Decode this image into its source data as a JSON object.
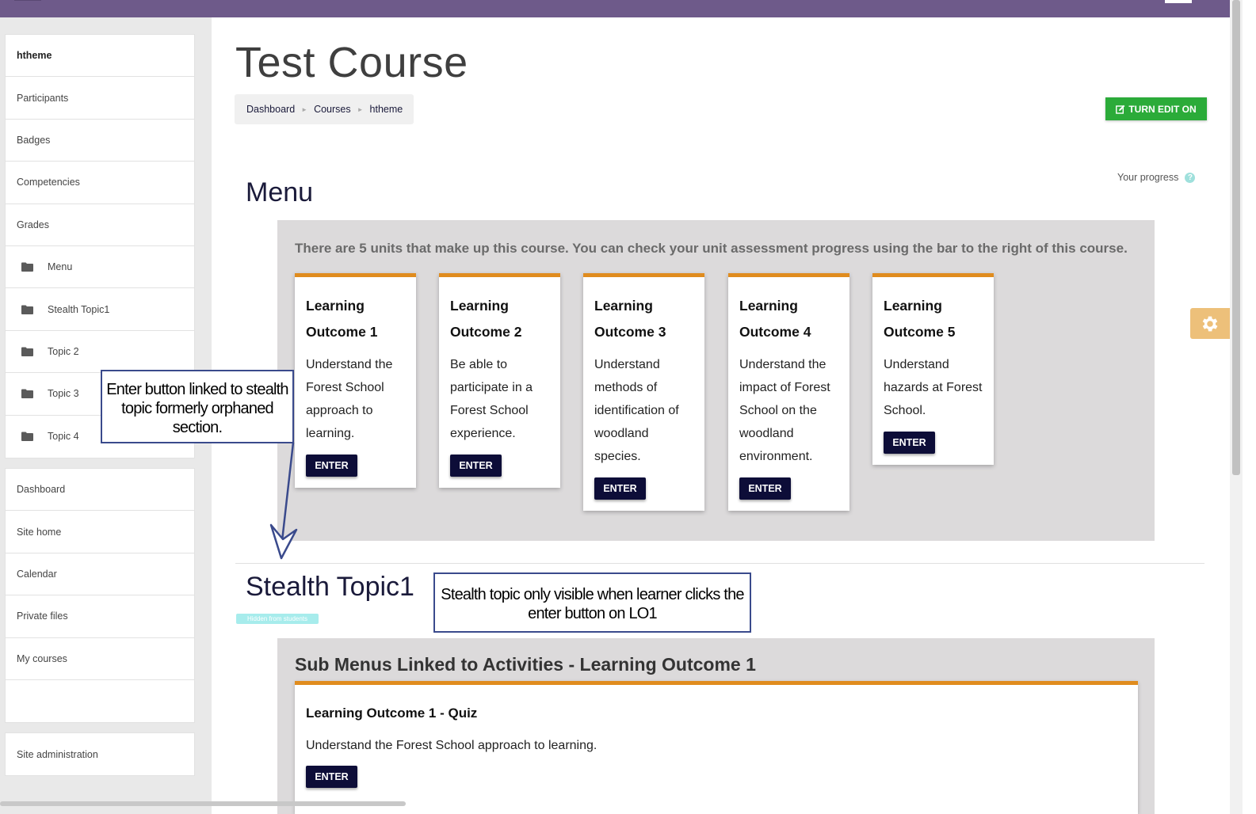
{
  "sidebar": {
    "block1": [
      {
        "label": "htheme",
        "bold": true
      },
      {
        "label": "Participants"
      },
      {
        "label": "Badges"
      },
      {
        "label": "Competencies"
      },
      {
        "label": "Grades"
      },
      {
        "label": "Menu",
        "icon": "folder-icon"
      },
      {
        "label": "Stealth Topic1",
        "icon": "folder-icon"
      },
      {
        "label": "Topic 2",
        "icon": "folder-icon"
      },
      {
        "label": "Topic 3",
        "icon": "folder-icon"
      },
      {
        "label": "Topic 4",
        "icon": "folder-icon"
      }
    ],
    "block2": [
      {
        "label": "Dashboard"
      },
      {
        "label": "Site home"
      },
      {
        "label": "Calendar"
      },
      {
        "label": "Private files"
      },
      {
        "label": "My courses"
      },
      {
        "label": ""
      }
    ],
    "block3": [
      {
        "label": "Site administration"
      }
    ]
  },
  "header": {
    "title": "Test Course",
    "breadcrumb": [
      "Dashboard",
      "Courses",
      "htheme"
    ],
    "edit_button": "TURN EDIT ON",
    "progress_label": "Your progress",
    "help_glyph": "?"
  },
  "menu_section": {
    "title": "Menu",
    "intro": "There are 5 units that make up this course. You can check your unit assessment progress using the bar to the right of this course.",
    "cards": [
      {
        "title": "Learning Outcome 1",
        "desc": "Understand the Forest School approach to learning.",
        "button": "ENTER"
      },
      {
        "title": "Learning Outcome 2",
        "desc": "Be able to participate in a Forest School experience.",
        "button": "ENTER"
      },
      {
        "title": "Learning Outcome 3",
        "desc": "Understand methods of identification of woodland species.",
        "button": "ENTER"
      },
      {
        "title": "Learning Outcome 4",
        "desc": "Understand the impact of Forest School on the woodland environment.",
        "button": "ENTER"
      },
      {
        "title": "Learning Outcome 5",
        "desc": "Understand hazards at Forest School.",
        "button": "ENTER"
      }
    ]
  },
  "stealth_section": {
    "title": "Stealth Topic1",
    "hidden_badge": "Hidden from students",
    "sub_heading": "Sub Menus Linked to Activities - Learning Outcome 1",
    "quiz": {
      "title": "Learning Outcome 1 - Quiz",
      "desc": "Understand the Forest School approach to learning.",
      "button": "ENTER"
    }
  },
  "annotations": {
    "callout1": "Enter button linked to stealth topic formerly orphaned section.",
    "callout2": "Stealth topic only visible when learner clicks the enter button on LO1"
  },
  "colors": {
    "topbar": "#6e5a8a",
    "accent_orange": "#e08c1e",
    "button_dark": "#0d0d38",
    "edit_green": "#2bab39",
    "callout_border": "#3a4a8c"
  }
}
